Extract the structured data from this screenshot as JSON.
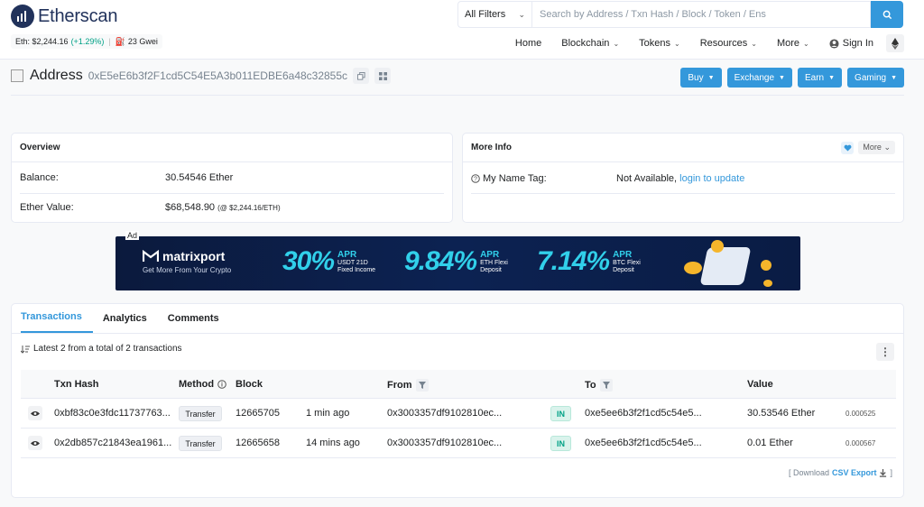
{
  "header": {
    "logo_text": "Etherscan",
    "eth_price_label": "Eth: $2,244.16",
    "eth_change": "(+1.29%)",
    "separator": "|",
    "gas": "23 Gwei",
    "filter_label": "All Filters",
    "search_placeholder": "Search by Address / Txn Hash / Block / Token / Ens"
  },
  "nav": {
    "home": "Home",
    "blockchain": "Blockchain",
    "tokens": "Tokens",
    "resources": "Resources",
    "more": "More",
    "signin": "Sign In"
  },
  "address": {
    "title": "Address",
    "hash": "0xE5eE6b3f2F1cd5C54E5A3b011EDBE6a48c32855c"
  },
  "actions": {
    "buy": "Buy",
    "exchange": "Exchange",
    "earn": "Earn",
    "gaming": "Gaming"
  },
  "overview": {
    "title": "Overview",
    "balance_label": "Balance:",
    "balance_value": "30.54546 Ether",
    "ether_value_label": "Ether Value:",
    "ether_value": "$68,548.90",
    "ether_value_rate": "(@ $2,244.16/ETH)"
  },
  "more_info": {
    "title": "More Info",
    "more_button": "More",
    "name_tag_label": "My Name Tag:",
    "name_tag_value": "Not Available,",
    "name_tag_link": "login to update"
  },
  "ad": {
    "tag": "Ad",
    "brand": "matrixport",
    "tagline": "Get More From Your Crypto",
    "offers": [
      {
        "pct": "30%",
        "apr": "APR",
        "line1": "USDT 21D",
        "line2": "Fixed Income"
      },
      {
        "pct": "9.84%",
        "apr": "APR",
        "line1": "ETH Flexi",
        "line2": "Deposit"
      },
      {
        "pct": "7.14%",
        "apr": "APR",
        "line1": "BTC Flexi",
        "line2": "Deposit"
      }
    ]
  },
  "tabs": {
    "transactions": "Transactions",
    "analytics": "Analytics",
    "comments": "Comments"
  },
  "transactions": {
    "summary": "Latest 2 from a total of 2 transactions",
    "columns": {
      "txn_hash": "Txn Hash",
      "method": "Method",
      "block": "Block",
      "from": "From",
      "to": "To",
      "value": "Value"
    },
    "rows": [
      {
        "hash": "0xbf83c0e3fdc11737763...",
        "method": "Transfer",
        "block": "12665705",
        "age": "1 min ago",
        "from": "0x3003357df9102810ec...",
        "direction": "IN",
        "to": "0xe5ee6b3f2f1cd5c54e5...",
        "value": "30.53546 Ether",
        "fee": "0.000525"
      },
      {
        "hash": "0x2db857c21843ea1961...",
        "method": "Transfer",
        "block": "12665658",
        "age": "14 mins ago",
        "from": "0x3003357df9102810ec...",
        "direction": "IN",
        "to": "0xe5ee6b3f2f1cd5c54e5...",
        "value": "0.01 Ether",
        "fee": "0.000567"
      }
    ],
    "download_prefix": "[ Download",
    "download_link": "CSV Export",
    "download_suffix": "]"
  },
  "colors": {
    "accent": "#3498db",
    "navy": "#21325b",
    "positive": "#00a186",
    "banner_cyan": "#31d0ea"
  }
}
